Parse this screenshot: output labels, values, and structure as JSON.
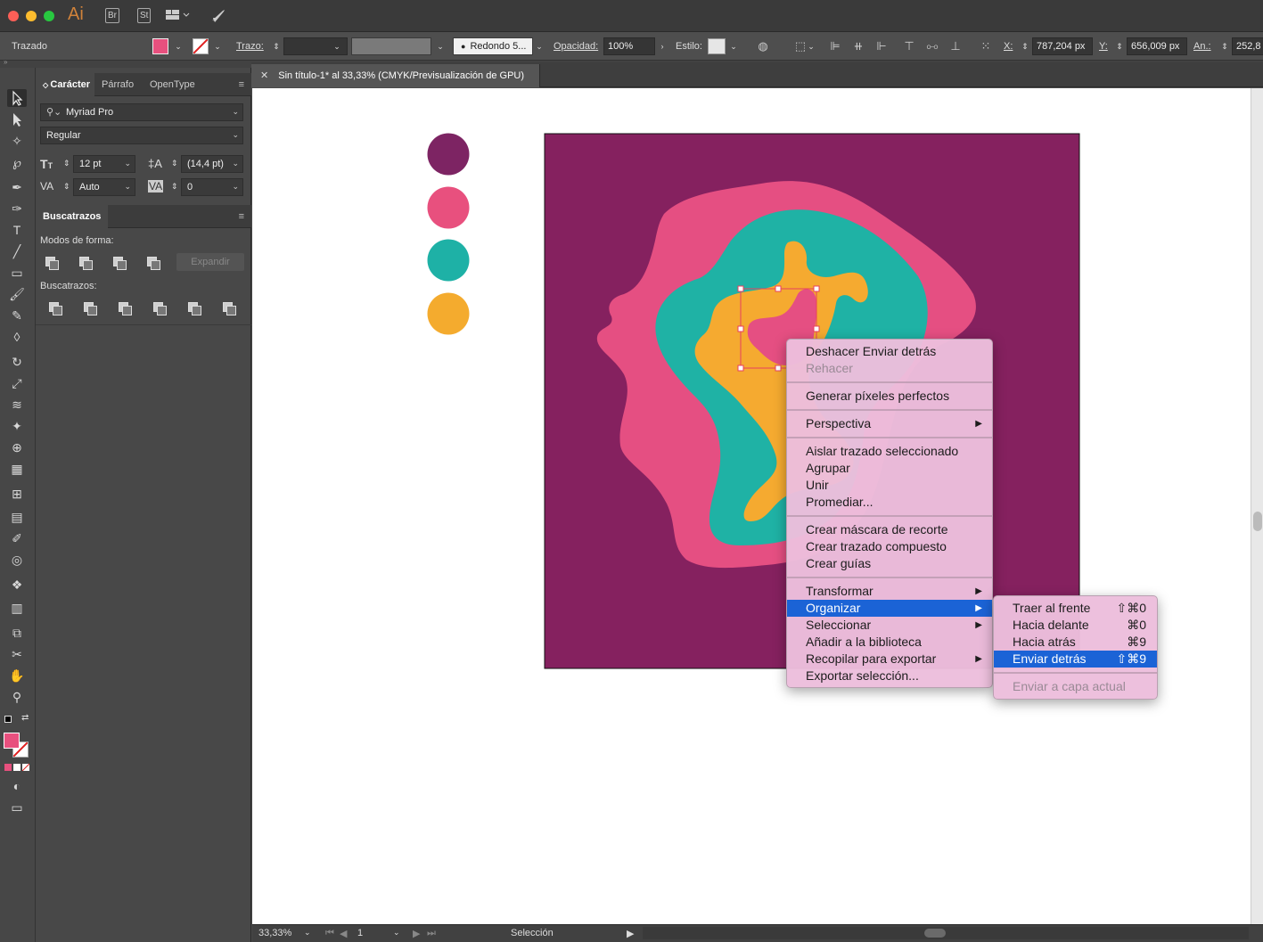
{
  "titlebar": {
    "app_icon": "Ai",
    "bridge": "Br",
    "stock": "St"
  },
  "controlbar": {
    "selection_type": "Trazado",
    "stroke_label": "Trazo:",
    "brush_label": "Redondo 5...",
    "opacity_label": "Opacidad:",
    "opacity_value": "100%",
    "style_label": "Estilo:",
    "x_label": "X:",
    "x_value": "787,204 px",
    "y_label": "Y:",
    "y_value": "656,009 px",
    "width_label": "An.:",
    "width_value": "252,8",
    "fill_color": "#e8507e"
  },
  "character_panel": {
    "tabs": [
      "Carácter",
      "Párrafo",
      "OpenType"
    ],
    "font_family": "Myriad Pro",
    "font_style": "Regular",
    "font_size": "12 pt",
    "leading": "(14,4 pt)",
    "kerning": "Auto",
    "tracking": "0"
  },
  "pathfinder_panel": {
    "title": "Buscatrazos",
    "shape_modes_label": "Modos de forma:",
    "expand_label": "Expandir",
    "pathfinders_label": "Buscatrazos:"
  },
  "document": {
    "tab_title": "Sin título-1* al 33,33% (CMYK/Previsualización de GPU)"
  },
  "swatches": {
    "colors": [
      "#7d2463",
      "#e8507e",
      "#1eb1a6",
      "#f4ab2e"
    ]
  },
  "artwork": {
    "background": "#85215f",
    "pink": "#e54f82",
    "teal": "#1fb2a5",
    "orange": "#f5aa30"
  },
  "statusbar": {
    "zoom": "33,33%",
    "artboard": "1",
    "tool": "Selección"
  },
  "context_menu": {
    "items": [
      {
        "label": "Deshacer Enviar detrás"
      },
      {
        "label": "Rehacer"
      },
      {
        "label": "Generar píxeles perfectos"
      },
      {
        "label": "Perspectiva"
      },
      {
        "label": "Aislar trazado seleccionado"
      },
      {
        "label": "Agrupar"
      },
      {
        "label": "Unir"
      },
      {
        "label": "Promediar..."
      },
      {
        "label": "Crear máscara de recorte"
      },
      {
        "label": "Crear trazado compuesto"
      },
      {
        "label": "Crear guías"
      },
      {
        "label": "Transformar"
      },
      {
        "label": "Organizar"
      },
      {
        "label": "Seleccionar"
      },
      {
        "label": "Añadir a la biblioteca"
      },
      {
        "label": "Recopilar para exportar"
      },
      {
        "label": "Exportar selección..."
      }
    ]
  },
  "submenu": {
    "items": [
      {
        "label": "Traer al frente",
        "shortcut": "⇧⌘0"
      },
      {
        "label": "Hacia delante",
        "shortcut": "⌘0"
      },
      {
        "label": "Hacia atrás",
        "shortcut": "⌘9"
      },
      {
        "label": "Enviar detrás",
        "shortcut": "⇧⌘9"
      },
      {
        "label": "Enviar a capa actual"
      }
    ]
  }
}
